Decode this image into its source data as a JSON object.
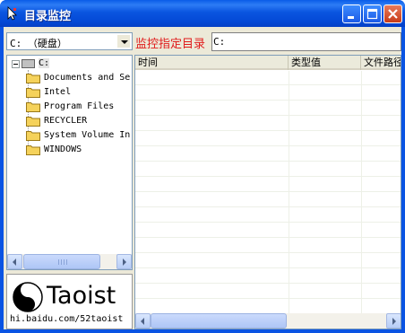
{
  "window": {
    "title": "目录监控"
  },
  "drive_select": {
    "value": "C: （硬盘）"
  },
  "monitor": {
    "label": "监控指定目录",
    "path_value": "C:"
  },
  "tree": {
    "root": "C:",
    "items": [
      "Documents and Se",
      "Intel",
      "Program Files",
      "RECYCLER",
      "System Volume In",
      "WINDOWS"
    ]
  },
  "logo": {
    "text": "Taoist",
    "url": "hi.baidu.com/52taoist"
  },
  "list": {
    "columns": [
      "时间",
      "类型值",
      "文件路径"
    ]
  },
  "colors": {
    "titlebar": "#0a54e3",
    "monitor_label": "#e01b1b",
    "folder": "#f5d25b"
  },
  "icons": {
    "app": "app-icon",
    "minimize": "minimize-icon",
    "maximize": "maximize-icon",
    "close": "close-icon",
    "folder": "folder-icon",
    "drive": "drive-icon",
    "yinyang": "yinyang-logo"
  }
}
